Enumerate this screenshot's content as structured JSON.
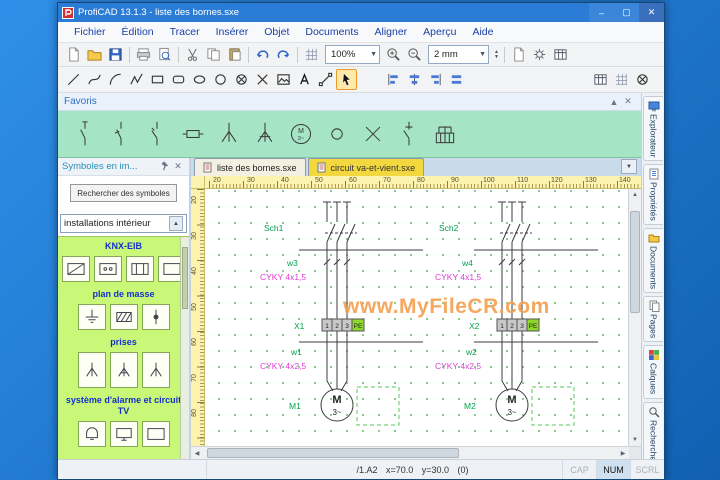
{
  "window": {
    "title": "ProfiCAD 13.1.3 - liste des bornes.sxe"
  },
  "menu": {
    "items": [
      "Fichier",
      "Édition",
      "Tracer",
      "Insérer",
      "Objet",
      "Documents",
      "Aligner",
      "Aperçu",
      "Aide"
    ]
  },
  "toolbar": {
    "zoom": "100%",
    "grid_size": "2 mm"
  },
  "favoris": {
    "title": "Favoris"
  },
  "glyphs": {
    "motor": "M",
    "phase": "3~"
  },
  "sidebar": {
    "title": "Symboles en im...",
    "search_button": "Rechercher des symboles",
    "category": "installations intérieur",
    "groups": [
      "KNX-EIB",
      "plan de masse",
      "prises",
      "système d'alarme et circuit TV"
    ]
  },
  "tabs": {
    "doc1": "liste des bornes.sxe",
    "doc2": "circuit va-et-vient.sxe"
  },
  "rulers": {
    "horizontal": [
      "20",
      "30",
      "40",
      "50",
      "60",
      "70",
      "80",
      "90",
      "100",
      "110",
      "120",
      "130",
      "140"
    ],
    "vertical": [
      "20",
      "30",
      "40",
      "50",
      "60",
      "70",
      "80"
    ]
  },
  "schematic": {
    "c1": {
      "breaker": "Sch1",
      "cable_top": "w3",
      "cable_top_type": "CYKY 4x1,5",
      "terminal": "X1",
      "t1": "1",
      "t2": "2",
      "t3": "3",
      "tpe": "PE",
      "cable_bottom": "w1",
      "cable_bottom_type": "CYKY 4x2,5",
      "motor": "M1"
    },
    "c2": {
      "breaker": "Sch2",
      "cable_top": "w4",
      "cable_top_type": "CYKY 4x1,5",
      "terminal": "X2",
      "t1": "1",
      "t2": "2",
      "t3": "3",
      "tpe": "PE",
      "cable_bottom": "w2",
      "cable_bottom_type": "CYKY 4x2,5",
      "motor": "M2"
    }
  },
  "watermark": "www.MyFileCR.com",
  "panel_tabs": [
    "Explorateur",
    "Propriétés",
    "Documents",
    "Pages",
    "Calques",
    "Recherche"
  ],
  "statusbar": {
    "position": "/1.A2   x=70.0   y=30.0 (0)",
    "cap": "CAP",
    "num": "NUM",
    "scrl": "SCRL"
  }
}
